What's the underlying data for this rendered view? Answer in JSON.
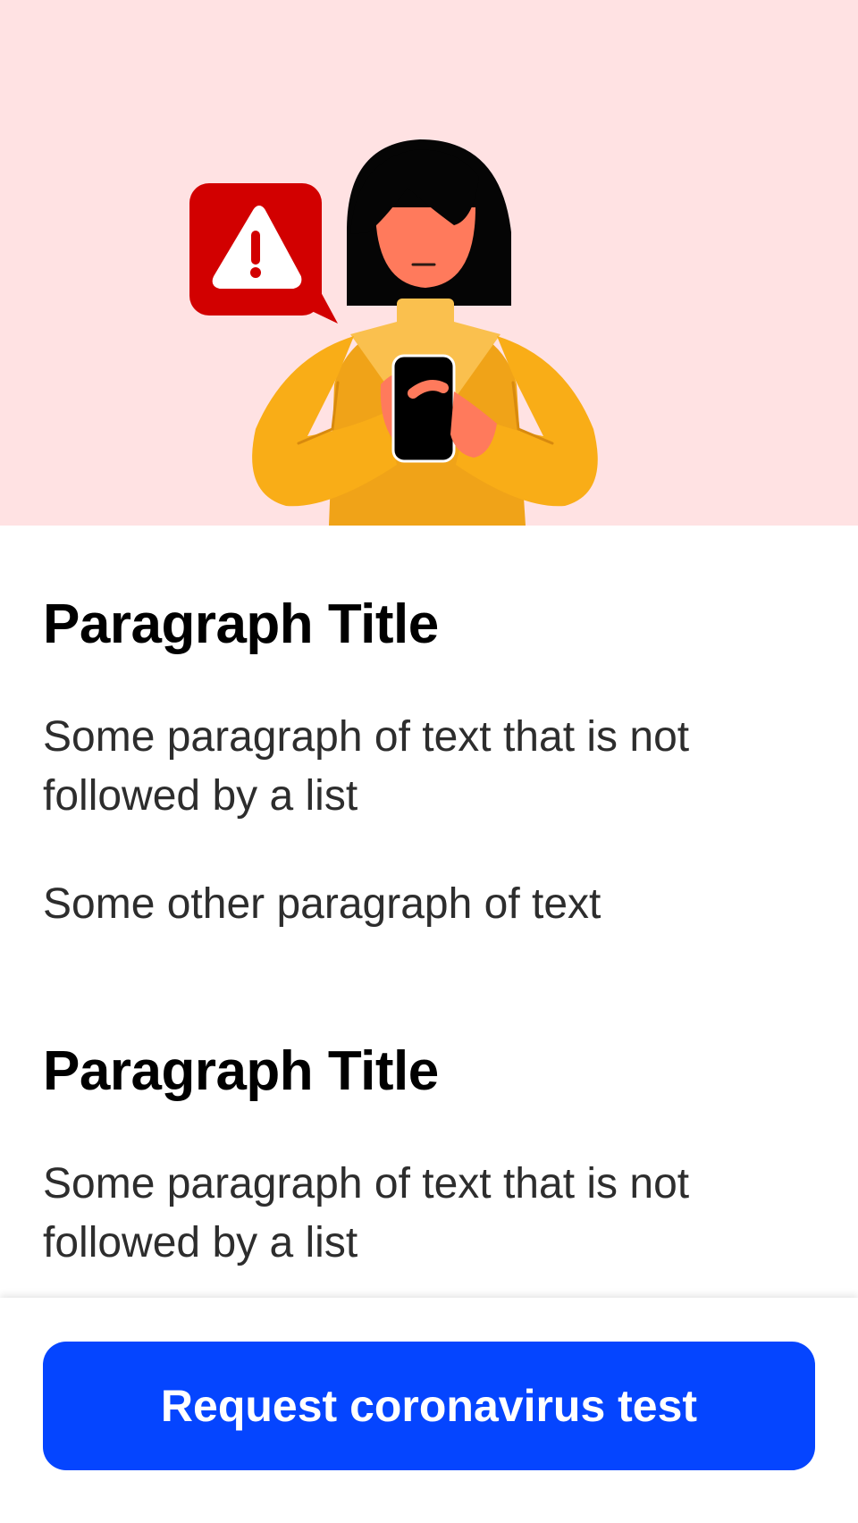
{
  "hero": {
    "illustration": "woman-reading-phone-alert-illustration",
    "alert_icon": "warning-triangle-icon",
    "background": "#ffe2e3"
  },
  "sections": [
    {
      "title": "Paragraph Title",
      "paragraphs": [
        "Some paragraph of text that is not followed by a list",
        "Some other paragraph of text"
      ]
    },
    {
      "title": "Paragraph Title",
      "paragraphs": [
        "Some paragraph of text that is not followed by a list"
      ]
    }
  ],
  "footer": {
    "button_label": "Request coronavirus test",
    "button_color": "#0545ff"
  },
  "colors": {
    "alert_red": "#d20000",
    "sweater": "#f9ad17",
    "skin": "#ff7a5c",
    "text_dark": "#2d2d2d"
  }
}
